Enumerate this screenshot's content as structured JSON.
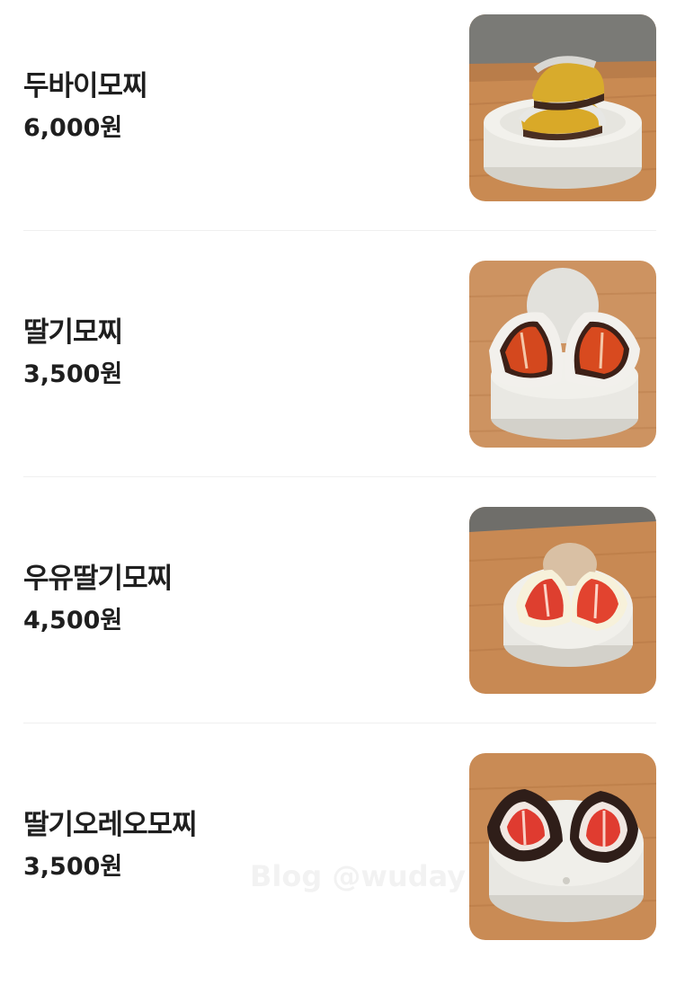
{
  "menu": {
    "items": [
      {
        "name": "두바이모찌",
        "price": "6,000원",
        "image": "dubai-mochi-photo"
      },
      {
        "name": "딸기모찌",
        "price": "3,500원",
        "image": "strawberry-mochi-photo"
      },
      {
        "name": "우유딸기모찌",
        "price": "4,500원",
        "image": "milk-strawberry-mochi-photo"
      },
      {
        "name": "딸기오레오모찌",
        "price": "3,500원",
        "image": "strawberry-oreo-mochi-photo"
      }
    ]
  },
  "watermark": "Blog @wuday",
  "colors": {
    "text": "#1f1f1f",
    "divider": "#f0f0f0",
    "background": "#ffffff",
    "wood": "#c98a52",
    "plate": "#ecece6"
  }
}
